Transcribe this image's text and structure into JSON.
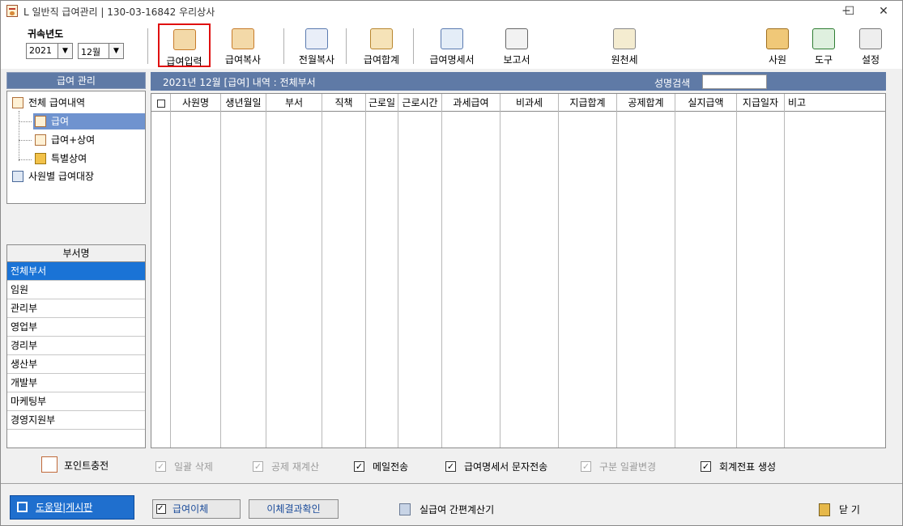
{
  "window": {
    "title": "L 일반직 급여관리 | 130-03-16842  우리상사",
    "controls": {
      "minimize": "─",
      "maximize": "☐",
      "close": "✕"
    }
  },
  "toolbar": {
    "fiscal_year_label": "귀속년도",
    "year_value": "2021",
    "month_value": "12월",
    "buttons": [
      {
        "label": "급여입력",
        "icon": "pay-input-icon",
        "selected": true
      },
      {
        "label": "급여복사",
        "icon": "pay-copy-icon"
      },
      {
        "label": "전월복사",
        "icon": "prev-month-copy-icon"
      },
      {
        "label": "급여합계",
        "icon": "pay-sum-icon"
      },
      {
        "label": "급여명세서",
        "icon": "payslip-mail-icon"
      },
      {
        "label": "보고서",
        "icon": "printer-icon"
      },
      {
        "label": "원천세",
        "icon": "withholding-tax-icon"
      },
      {
        "label": "사원",
        "icon": "employee-icon"
      },
      {
        "label": "도구",
        "icon": "excel-tool-icon"
      },
      {
        "label": "설정",
        "icon": "settings-icon"
      }
    ]
  },
  "left_panel": {
    "header": "급여 관리",
    "tree": {
      "root": "전체 급여내역",
      "children": [
        "급여",
        "급여+상여",
        "특별상여"
      ],
      "selected": "급여",
      "other": "사원별 급여대장"
    }
  },
  "dept_panel": {
    "header": "부서명",
    "items": [
      "전체부서",
      "임원",
      "관리부",
      "영업부",
      "경리부",
      "생산부",
      "개발부",
      "마케팅부",
      "경영지원부"
    ],
    "selected": "전체부서"
  },
  "content": {
    "title": "2021년 12월 [급여] 내역 : 전체부서",
    "search_label": "성명검색",
    "search_value": "",
    "columns": [
      "사원명",
      "생년월일",
      "부서",
      "직책",
      "근로일",
      "근로시간",
      "과세급여",
      "비과세",
      "지급합계",
      "공제합계",
      "실지급액",
      "지급일자",
      "비고"
    ]
  },
  "options": {
    "point_charge": "포인트충전",
    "checks": [
      {
        "label": "일괄 삭제",
        "checked": true,
        "disabled": true
      },
      {
        "label": "공제 재계산",
        "checked": true,
        "disabled": true
      },
      {
        "label": "메일전송",
        "checked": true,
        "disabled": false
      },
      {
        "label": "급여명세서 문자전송",
        "checked": true,
        "disabled": false
      },
      {
        "label": "구분 일괄변경",
        "checked": true,
        "disabled": true
      },
      {
        "label": "회계전표 생성",
        "checked": true,
        "disabled": false
      }
    ]
  },
  "bottom": {
    "help_button": "도움말|게시판",
    "transfer_button": "급여이체",
    "transfer_result_button": "이체결과확인",
    "calculator_label": "실급여 간편계산기",
    "close_label": "닫 기"
  },
  "colors": {
    "header_bg": "#5f7aa6",
    "selected_node": "#6f93cf",
    "selected_dept": "#1a73d6",
    "highlight_border": "#e01010",
    "help_button_bg": "#1f6fce"
  }
}
